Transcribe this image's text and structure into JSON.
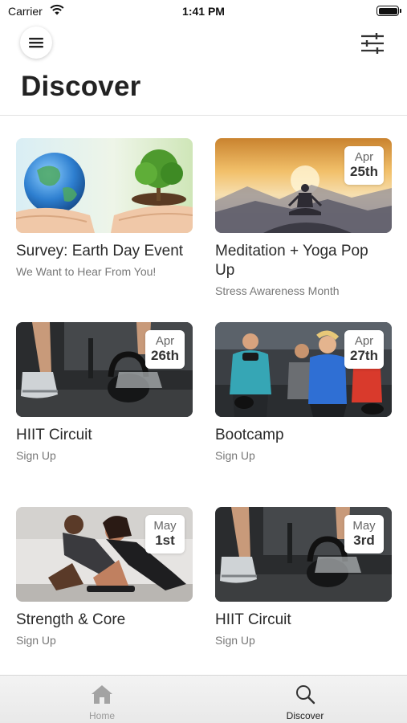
{
  "status_bar": {
    "carrier": "Carrier",
    "time": "1:41 PM"
  },
  "header": {
    "title": "Discover",
    "menu_icon": "hamburger-icon",
    "filter_icon": "sliders-icon"
  },
  "cards": [
    {
      "title": "Survey: Earth Day Event",
      "subtitle": "We Want to Hear From You!",
      "image": "earth-and-tree-in-hands",
      "badge": null
    },
    {
      "title": "Meditation + Yoga Pop Up",
      "subtitle": "Stress Awareness Month",
      "image": "meditation-sunset",
      "badge": {
        "month": "Apr",
        "day": "25th"
      }
    },
    {
      "title": "HIIT Circuit",
      "subtitle": "Sign Up",
      "image": "kettlebell-gym",
      "badge": {
        "month": "Apr",
        "day": "26th"
      }
    },
    {
      "title": "Bootcamp",
      "subtitle": "Sign Up",
      "image": "group-fitness-class",
      "badge": {
        "month": "Apr",
        "day": "27th"
      }
    },
    {
      "title": "Strength & Core",
      "subtitle": "Sign Up",
      "image": "plank-couple",
      "badge": {
        "month": "May",
        "day": "1st"
      }
    },
    {
      "title": "HIIT Circuit",
      "subtitle": "Sign Up",
      "image": "kettlebell-gym",
      "badge": {
        "month": "May",
        "day": "3rd"
      }
    }
  ],
  "tab_bar": {
    "tabs": [
      {
        "label": "Home",
        "icon": "home-icon",
        "active": false
      },
      {
        "label": "Discover",
        "icon": "search-icon",
        "active": true
      }
    ],
    "active_color": "#222222",
    "inactive_color": "#999999"
  }
}
